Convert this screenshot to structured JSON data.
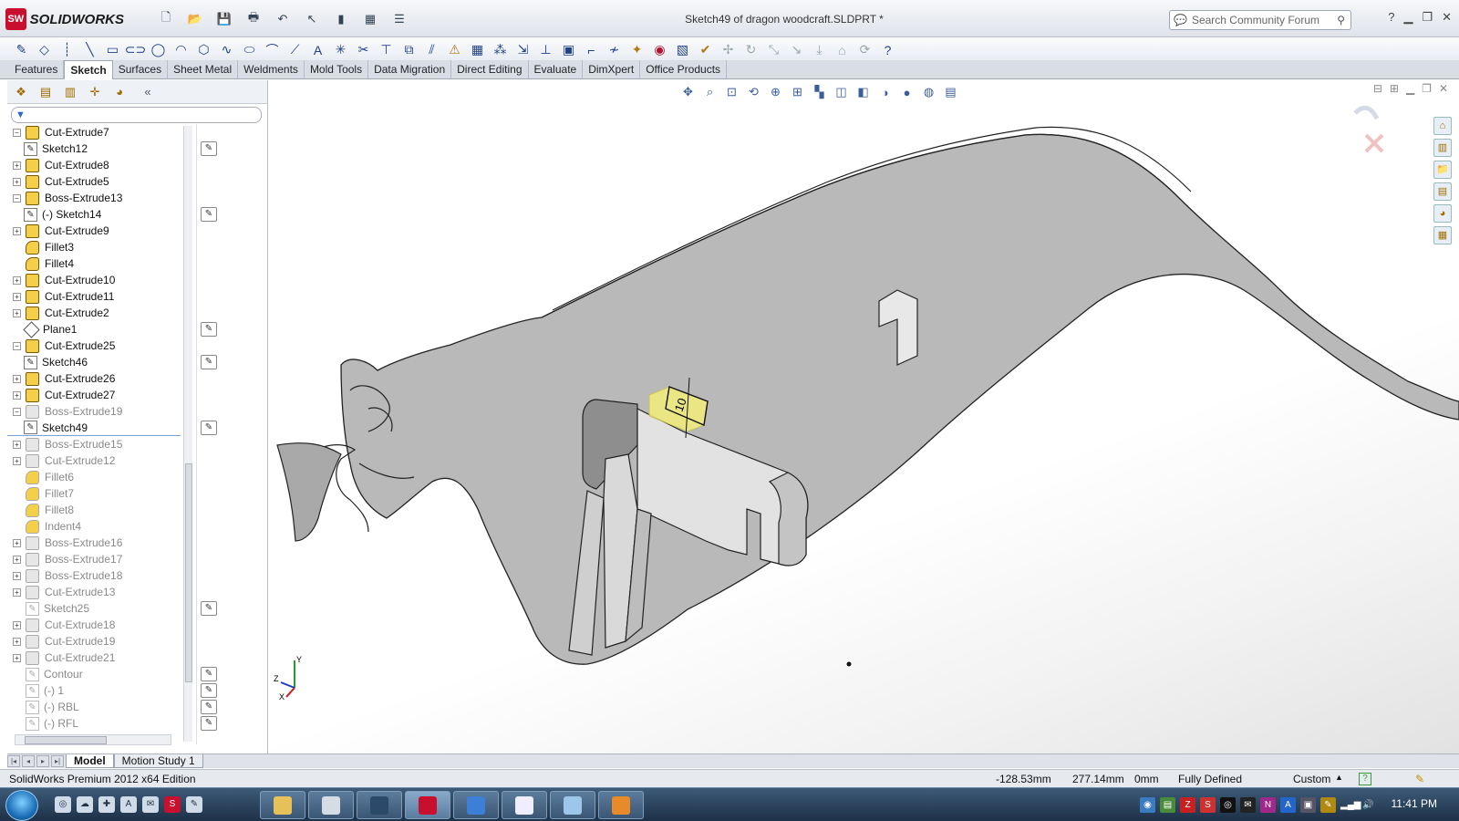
{
  "app": {
    "brand": "SOLIDWORKS",
    "logo_badge": "SW",
    "document_title": "Sketch49 of dragon woodcraft.SLDPRT *",
    "search_placeholder": "Search Community Forum"
  },
  "command_tabs": [
    "Features",
    "Sketch",
    "Surfaces",
    "Sheet Metal",
    "Weldments",
    "Mold Tools",
    "Data Migration",
    "Direct Editing",
    "Evaluate",
    "DimXpert",
    "Office Products"
  ],
  "active_tab": "Sketch",
  "feature_tree": [
    {
      "label": "Cut-Extrude7",
      "kind": "feature",
      "expand": "−",
      "state": "normal"
    },
    {
      "label": "Sketch12",
      "kind": "sketch",
      "state": "normal"
    },
    {
      "label": "Cut-Extrude8",
      "kind": "feature",
      "expand": "+",
      "state": "normal"
    },
    {
      "label": "Cut-Extrude5",
      "kind": "feature",
      "expand": "+",
      "state": "normal"
    },
    {
      "label": "Boss-Extrude13",
      "kind": "feature",
      "expand": "−",
      "state": "normal"
    },
    {
      "label": "(-) Sketch14",
      "kind": "sketch",
      "state": "normal"
    },
    {
      "label": "Cut-Extrude9",
      "kind": "feature",
      "expand": "+",
      "state": "normal"
    },
    {
      "label": "Fillet3",
      "kind": "fillet",
      "state": "normal"
    },
    {
      "label": "Fillet4",
      "kind": "fillet",
      "state": "normal"
    },
    {
      "label": "Cut-Extrude10",
      "kind": "feature",
      "expand": "+",
      "state": "normal"
    },
    {
      "label": "Cut-Extrude11",
      "kind": "feature",
      "expand": "+",
      "state": "normal"
    },
    {
      "label": "Cut-Extrude2",
      "kind": "feature",
      "expand": "+",
      "state": "normal"
    },
    {
      "label": "Plane1",
      "kind": "plane",
      "state": "normal"
    },
    {
      "label": "Cut-Extrude25",
      "kind": "feature",
      "expand": "−",
      "state": "normal"
    },
    {
      "label": "Sketch46",
      "kind": "sketch",
      "state": "normal"
    },
    {
      "label": "Cut-Extrude26",
      "kind": "feature",
      "expand": "+",
      "state": "normal"
    },
    {
      "label": "Cut-Extrude27",
      "kind": "feature",
      "expand": "+",
      "state": "normal"
    },
    {
      "label": "Boss-Extrude19",
      "kind": "feature",
      "expand": "−",
      "state": "grey"
    },
    {
      "label": "Sketch49",
      "kind": "sketch",
      "state": "selected"
    },
    {
      "label": "Boss-Extrude15",
      "kind": "feature",
      "expand": "+",
      "state": "grey"
    },
    {
      "label": "Cut-Extrude12",
      "kind": "feature",
      "expand": "+",
      "state": "grey"
    },
    {
      "label": "Fillet6",
      "kind": "fillet",
      "state": "grey"
    },
    {
      "label": "Fillet7",
      "kind": "fillet",
      "state": "grey"
    },
    {
      "label": "Fillet8",
      "kind": "fillet",
      "state": "grey"
    },
    {
      "label": "Indent4",
      "kind": "fillet",
      "state": "grey"
    },
    {
      "label": "Boss-Extrude16",
      "kind": "feature",
      "expand": "+",
      "state": "grey"
    },
    {
      "label": "Boss-Extrude17",
      "kind": "feature",
      "expand": "+",
      "state": "grey"
    },
    {
      "label": "Boss-Extrude18",
      "kind": "feature",
      "expand": "+",
      "state": "grey"
    },
    {
      "label": "Cut-Extrude13",
      "kind": "feature",
      "expand": "+",
      "state": "grey"
    },
    {
      "label": "Sketch25",
      "kind": "sketch-top",
      "state": "grey"
    },
    {
      "label": "Cut-Extrude18",
      "kind": "feature",
      "expand": "+",
      "state": "grey"
    },
    {
      "label": "Cut-Extrude19",
      "kind": "feature",
      "expand": "+",
      "state": "grey"
    },
    {
      "label": "Cut-Extrude21",
      "kind": "feature",
      "expand": "+",
      "state": "grey"
    },
    {
      "label": "Contour",
      "kind": "sketch-top",
      "state": "grey"
    },
    {
      "label": "(-) 1",
      "kind": "sketch-top",
      "state": "grey"
    },
    {
      "label": "(-) RBL",
      "kind": "sketch-top",
      "state": "grey"
    },
    {
      "label": "(-) RFL",
      "kind": "sketch-top",
      "state": "grey"
    }
  ],
  "bottom_tabs": [
    "Model",
    "Motion Study 1"
  ],
  "dimension_label": "10",
  "triad": {
    "x": "X",
    "y": "Y",
    "z": "Z"
  },
  "status": {
    "edition": "SolidWorks Premium 2012 x64 Edition",
    "x": "-128.53mm",
    "y": "277.14mm",
    "z": "0mm",
    "state": "Fully Defined",
    "units": "Custom"
  },
  "clock": "11:41 PM",
  "colors": {
    "brand_red": "#c8102e",
    "sketch_blue": "#1f3f8a",
    "selection_yellow": "#f2ee7a"
  }
}
